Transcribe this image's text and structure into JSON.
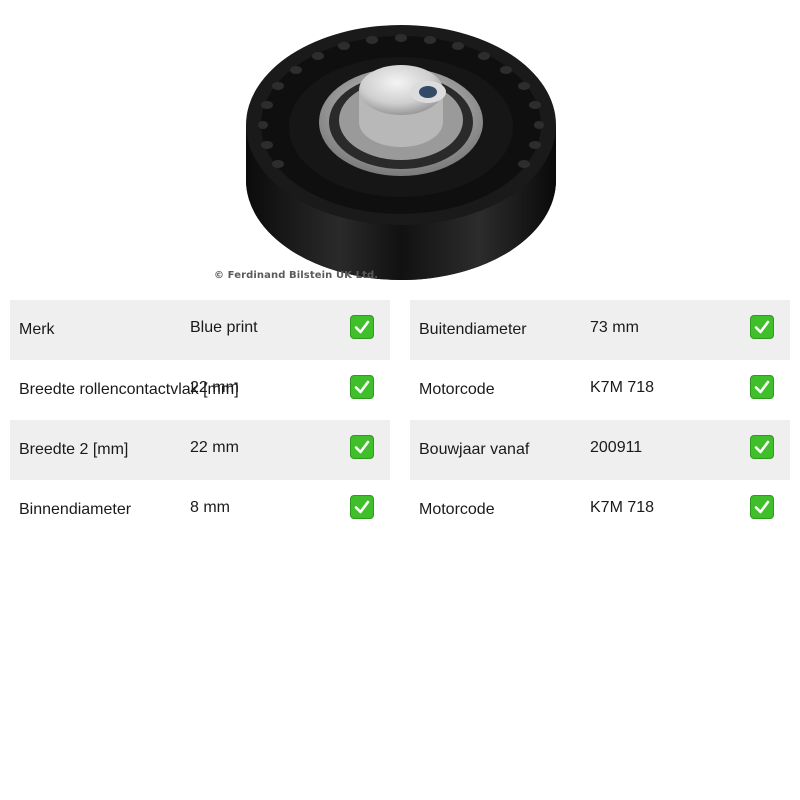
{
  "product": {
    "copyright": "© Ferdinand Bilstein UK Ltd.",
    "image_icon": "tensioner-pulley-image",
    "check_color": "#3fbf2a",
    "row_shade_color": "#efefef"
  },
  "specs_left": [
    {
      "label": "Merk",
      "value": "Blue print",
      "check_icon": "check-mark-icon"
    },
    {
      "label": "Breedte rollencontactvlak [mm]",
      "value": "22 mm",
      "check_icon": "check-mark-icon"
    },
    {
      "label": "Breedte 2 [mm]",
      "value": "22 mm",
      "check_icon": "check-mark-icon"
    },
    {
      "label": "Binnendiameter",
      "value": "8 mm",
      "check_icon": "check-mark-icon"
    }
  ],
  "specs_right": [
    {
      "label": "Buitendiameter",
      "value": "73 mm",
      "check_icon": "check-mark-icon"
    },
    {
      "label": "Motorcode",
      "value": "K7M 718",
      "check_icon": "check-mark-icon"
    },
    {
      "label": "Bouwjaar vanaf",
      "value": "200911",
      "check_icon": "check-mark-icon"
    },
    {
      "label": "Motorcode",
      "value": "K7M 718",
      "check_icon": "check-mark-icon"
    }
  ]
}
